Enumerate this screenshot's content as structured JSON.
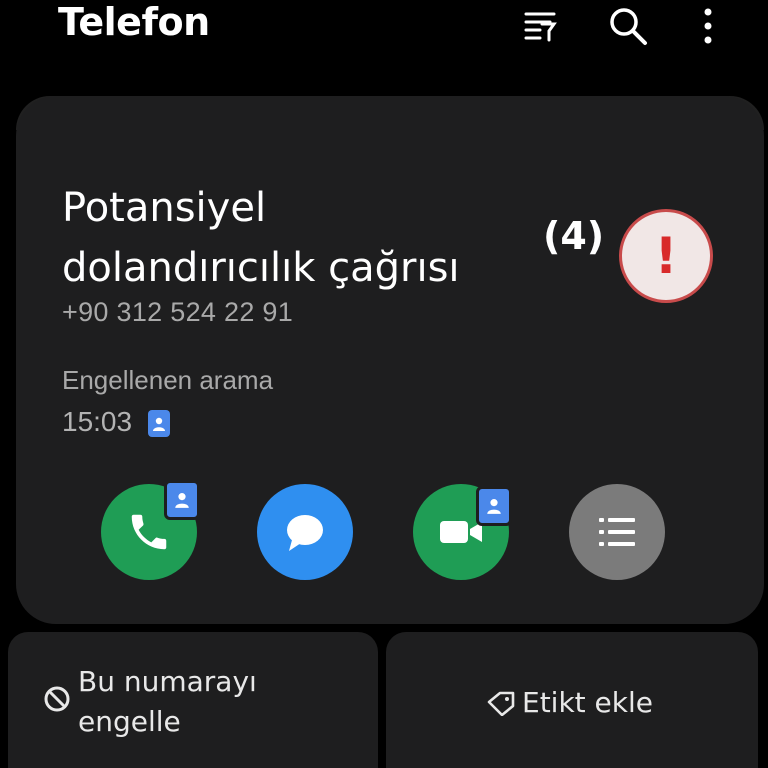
{
  "app": {
    "title": "Telefon"
  },
  "header_icons": [
    "filter-icon",
    "search-icon",
    "more-vert-icon"
  ],
  "card": {
    "caller_name": "Potansiyel dolandırıcılık çağrısı",
    "call_count": "(4)",
    "alert_symbol": "!",
    "phone_number": "+90 312 524 22 91",
    "call_status": "Engellenen arama",
    "time": "15:03",
    "actions": [
      {
        "name": "call",
        "icon": "phone-icon",
        "color": "#1f9d55"
      },
      {
        "name": "message",
        "icon": "chat-bubble-icon",
        "color": "#2f8ff0"
      },
      {
        "name": "video-call",
        "icon": "video-camera-icon",
        "color": "#1f9d55"
      },
      {
        "name": "details",
        "icon": "list-icon",
        "color": "#7b7b7b"
      }
    ]
  },
  "bottom_actions": {
    "block_label": "Bu numarayı engelle",
    "tag_label": "Etikt ekle"
  },
  "colors": {
    "accent_blue": "#4b88ea",
    "alert_red": "#d82a2a",
    "background": "#000000",
    "card": "#1e1e1f"
  }
}
